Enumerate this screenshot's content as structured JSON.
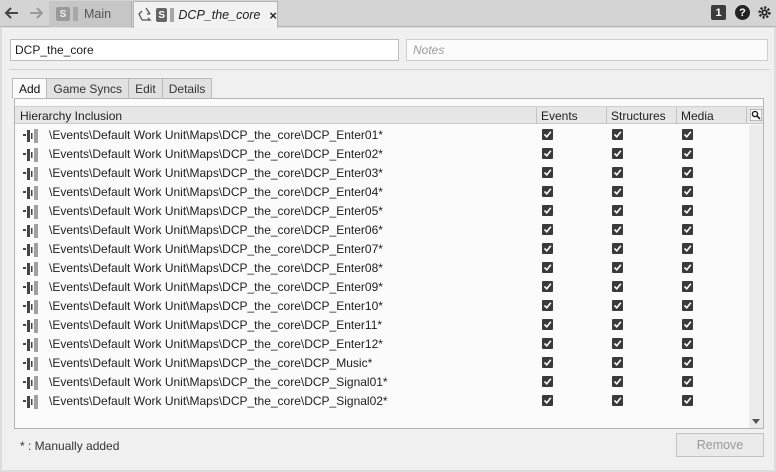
{
  "topbar": {
    "tabs": [
      {
        "label": "Main",
        "icon": "soundbank-icon",
        "active": false
      },
      {
        "label": "DCP_the_core",
        "icon": "soundbank-icon",
        "active": true,
        "close": "×"
      }
    ],
    "soundbank_glyph": "S",
    "badge": "1",
    "help": "?"
  },
  "editor": {
    "name_value": "DCP_the_core",
    "notes_placeholder": "Notes",
    "subtabs": [
      "Add",
      "Game Syncs",
      "Edit",
      "Details"
    ],
    "active_subtab": "Add"
  },
  "list": {
    "columns": {
      "hierarchy": "Hierarchy Inclusion",
      "events": "Events",
      "structures": "Structures",
      "media": "Media"
    },
    "rows": [
      {
        "path": "\\Events\\Default Work Unit\\Maps\\DCP_the_core\\DCP_Enter01*",
        "events": true,
        "structures": true,
        "media": true
      },
      {
        "path": "\\Events\\Default Work Unit\\Maps\\DCP_the_core\\DCP_Enter02*",
        "events": true,
        "structures": true,
        "media": true
      },
      {
        "path": "\\Events\\Default Work Unit\\Maps\\DCP_the_core\\DCP_Enter03*",
        "events": true,
        "structures": true,
        "media": true
      },
      {
        "path": "\\Events\\Default Work Unit\\Maps\\DCP_the_core\\DCP_Enter04*",
        "events": true,
        "structures": true,
        "media": true
      },
      {
        "path": "\\Events\\Default Work Unit\\Maps\\DCP_the_core\\DCP_Enter05*",
        "events": true,
        "structures": true,
        "media": true
      },
      {
        "path": "\\Events\\Default Work Unit\\Maps\\DCP_the_core\\DCP_Enter06*",
        "events": true,
        "structures": true,
        "media": true
      },
      {
        "path": "\\Events\\Default Work Unit\\Maps\\DCP_the_core\\DCP_Enter07*",
        "events": true,
        "structures": true,
        "media": true
      },
      {
        "path": "\\Events\\Default Work Unit\\Maps\\DCP_the_core\\DCP_Enter08*",
        "events": true,
        "structures": true,
        "media": true
      },
      {
        "path": "\\Events\\Default Work Unit\\Maps\\DCP_the_core\\DCP_Enter09*",
        "events": true,
        "structures": true,
        "media": true
      },
      {
        "path": "\\Events\\Default Work Unit\\Maps\\DCP_the_core\\DCP_Enter10*",
        "events": true,
        "structures": true,
        "media": true
      },
      {
        "path": "\\Events\\Default Work Unit\\Maps\\DCP_the_core\\DCP_Enter11*",
        "events": true,
        "structures": true,
        "media": true
      },
      {
        "path": "\\Events\\Default Work Unit\\Maps\\DCP_the_core\\DCP_Enter12*",
        "events": true,
        "structures": true,
        "media": true
      },
      {
        "path": "\\Events\\Default Work Unit\\Maps\\DCP_the_core\\DCP_Music*",
        "events": true,
        "structures": true,
        "media": true
      },
      {
        "path": "\\Events\\Default Work Unit\\Maps\\DCP_the_core\\DCP_Signal01*",
        "events": true,
        "structures": true,
        "media": true
      },
      {
        "path": "\\Events\\Default Work Unit\\Maps\\DCP_the_core\\DCP_Signal02*",
        "events": true,
        "structures": true,
        "media": true
      }
    ]
  },
  "footer": {
    "note": "* : Manually added",
    "remove_label": "Remove"
  },
  "colors": {
    "checkbox": "#3a3a3a",
    "panel_bg": "#fbfbfb",
    "header_bg": "#e6e6e6"
  }
}
